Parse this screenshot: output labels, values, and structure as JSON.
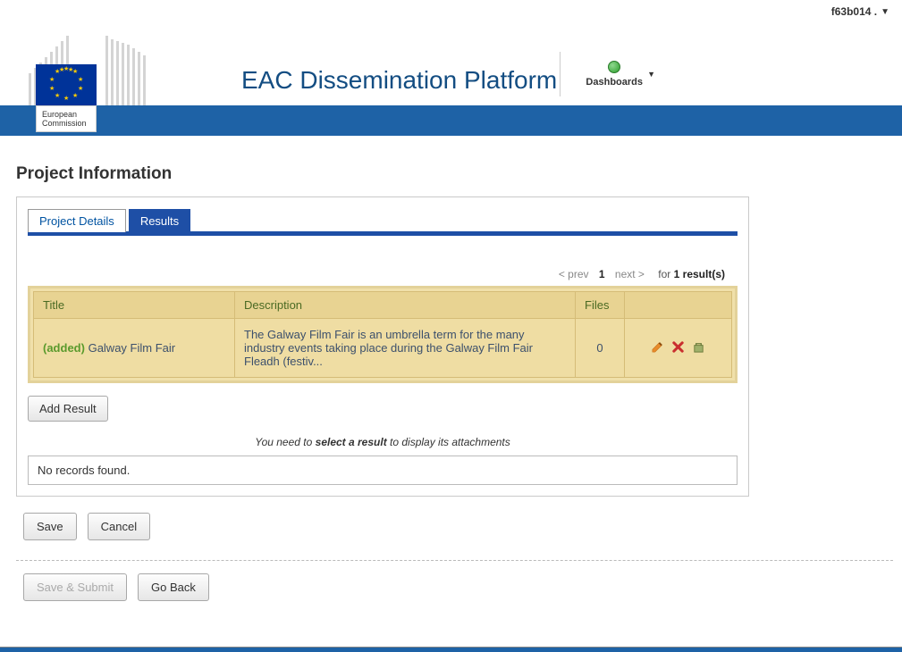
{
  "topbar": {
    "user": "f63b014 ."
  },
  "header": {
    "logo_label_line1": "European",
    "logo_label_line2": "Commission",
    "platform_title": "EAC Dissemination Platform",
    "dashboards_label": "Dashboards"
  },
  "page": {
    "title": "Project Information"
  },
  "tabs": {
    "details": "Project Details",
    "results": "Results"
  },
  "pager": {
    "prev": "< prev",
    "current": "1",
    "next": "next >",
    "for_prefix": "for ",
    "count": "1",
    "for_suffix": " result(s)"
  },
  "table": {
    "headers": {
      "title": "Title",
      "description": "Description",
      "files": "Files"
    },
    "row": {
      "tag": "(added)",
      "title": "Galway Film Fair",
      "description": "The Galway Film Fair is an umbrella term for the many industry events taking place during the Galway Film Fair Fleadh (festiv...",
      "files": "0"
    }
  },
  "actions": {
    "add_result": "Add Result"
  },
  "hint": {
    "pre": "You need to ",
    "bold": "select a result",
    "post": " to display its attachments"
  },
  "norecords": "No records found.",
  "buttons": {
    "save": "Save",
    "cancel": "Cancel",
    "save_submit": "Save & Submit",
    "go_back": "Go Back"
  }
}
